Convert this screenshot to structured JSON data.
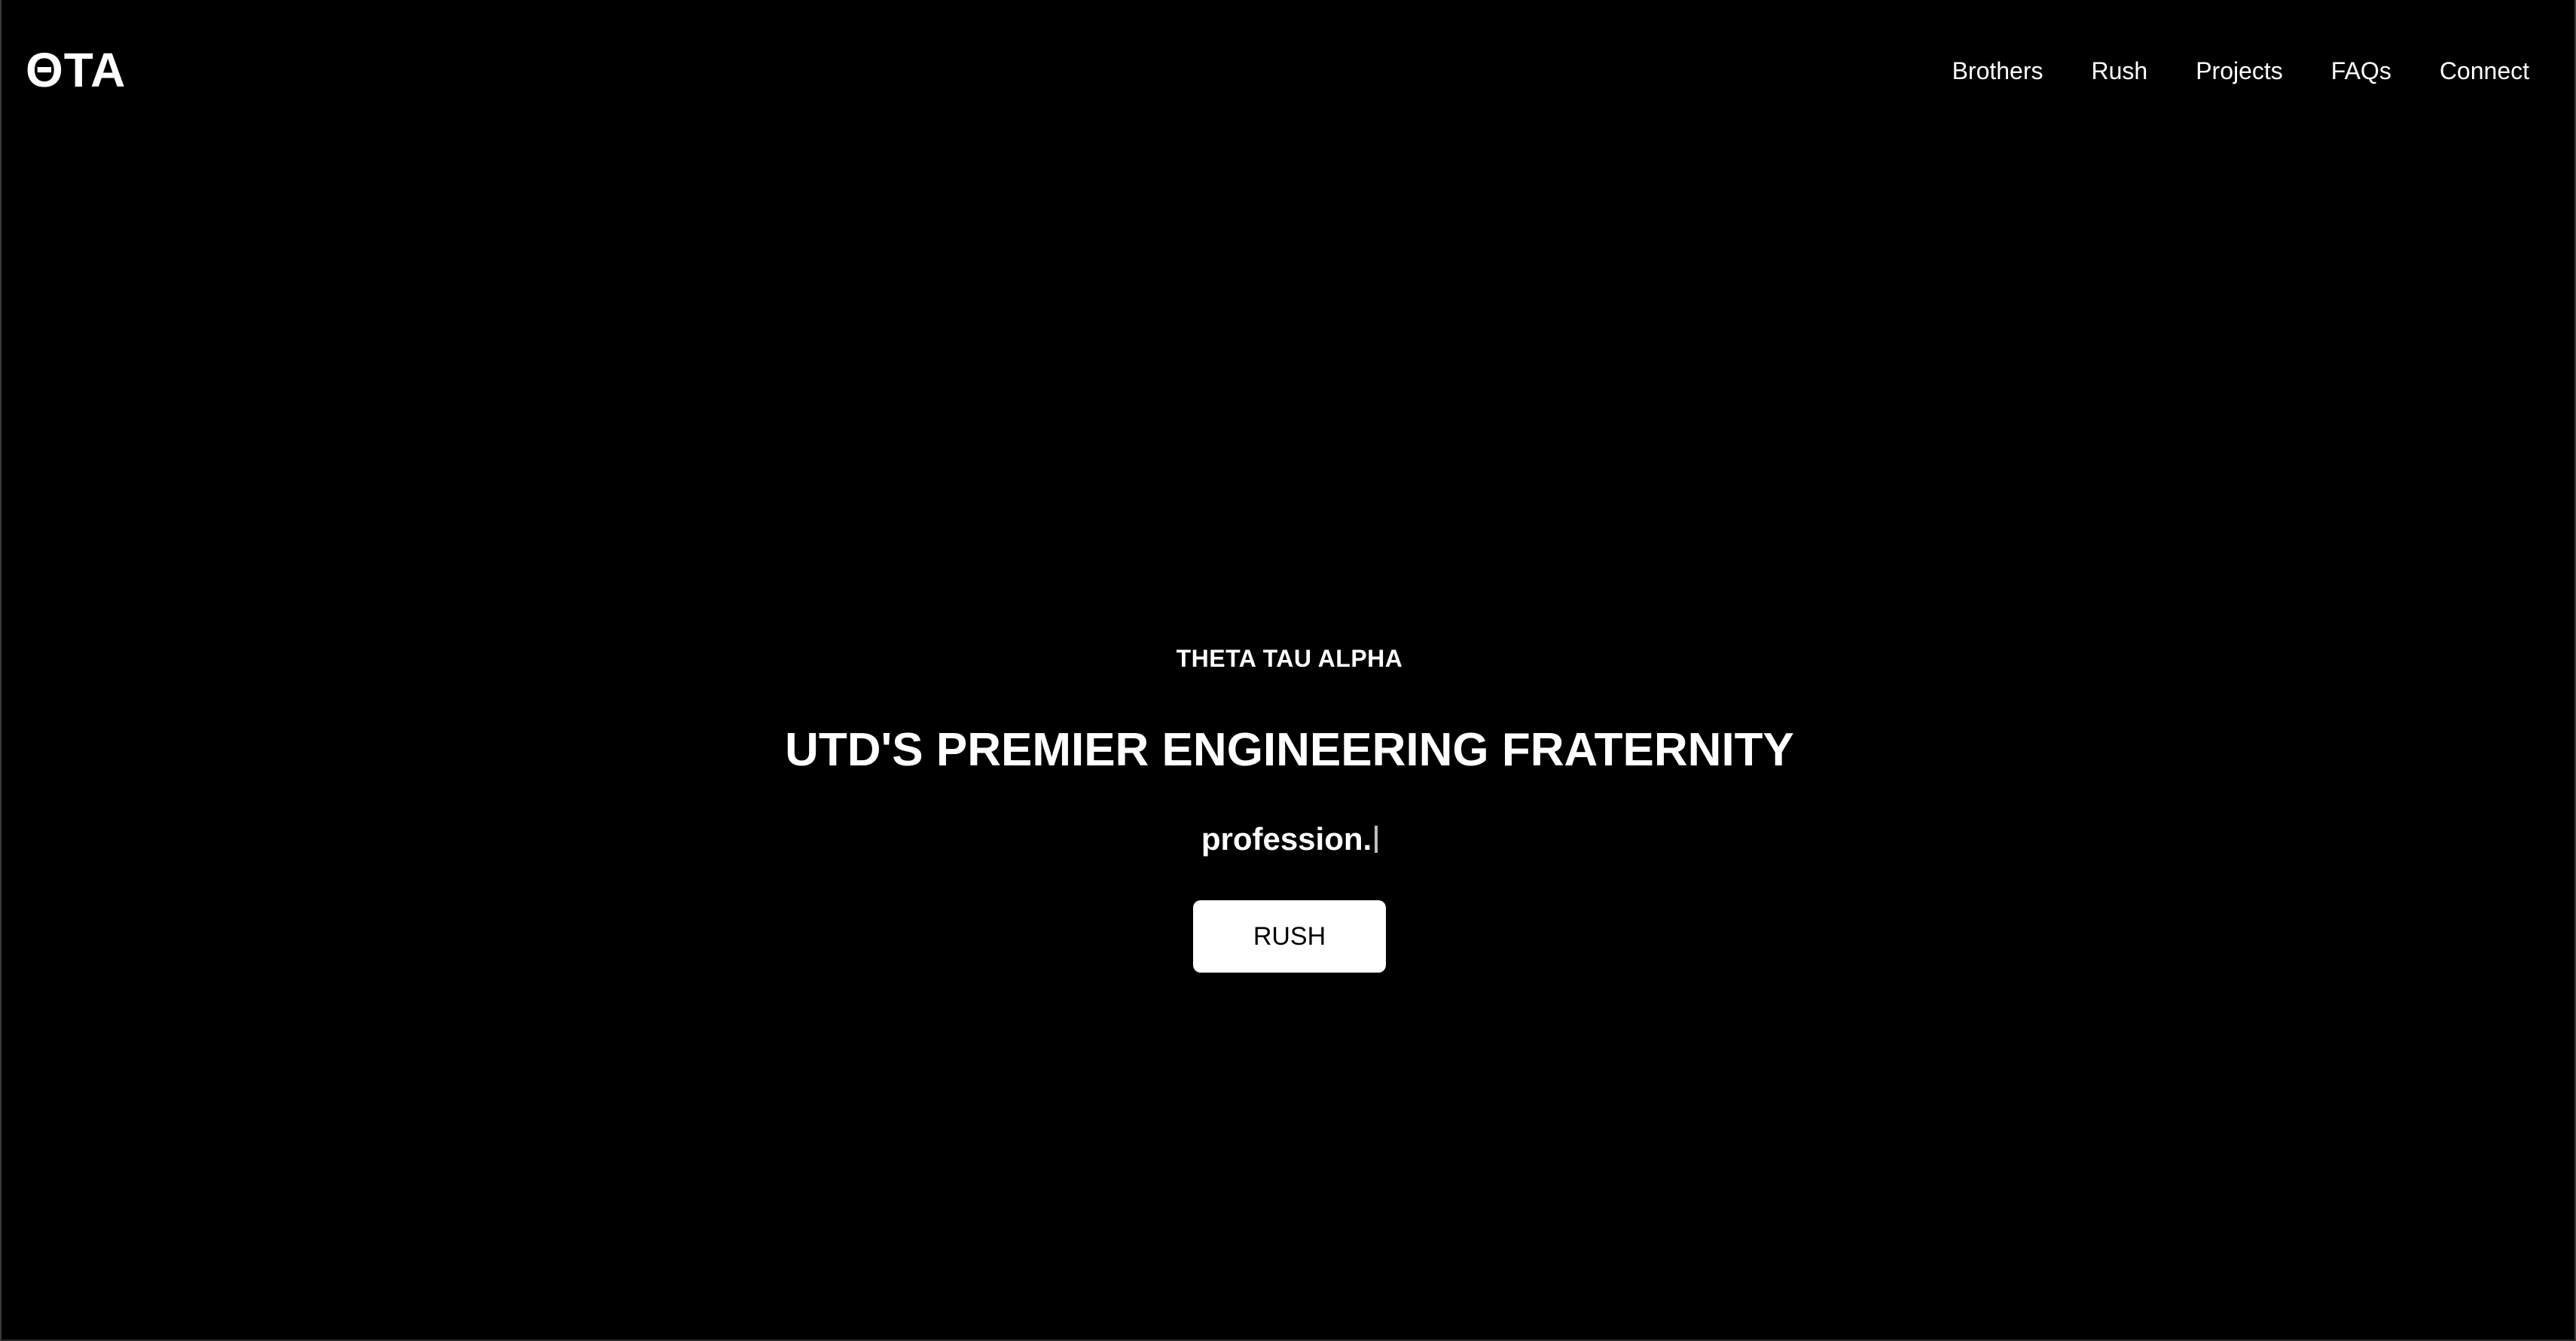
{
  "header": {
    "logo": "ΘTA",
    "nav": [
      {
        "label": "Brothers"
      },
      {
        "label": "Rush"
      },
      {
        "label": "Projects"
      },
      {
        "label": "FAQs"
      },
      {
        "label": "Connect"
      }
    ]
  },
  "hero": {
    "eyebrow": "THETA TAU ALPHA",
    "headline": "UTD'S PREMIER ENGINEERING FRATERNITY",
    "typed_text": "profession.",
    "cta_label": "RUSH"
  },
  "colors": {
    "background": "#000000",
    "text": "#ffffff",
    "button_bg": "#ffffff",
    "button_text": "#000000"
  }
}
